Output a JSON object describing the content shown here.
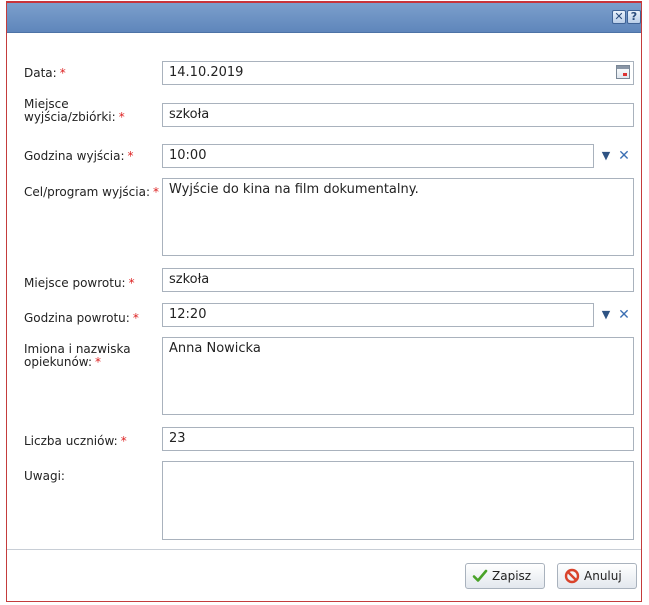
{
  "window": {
    "close_icon": "close-icon",
    "help_label": "?"
  },
  "form": {
    "date": {
      "label": "Data:",
      "value": "14.10.2019",
      "icon": "calendar-icon"
    },
    "place_out": {
      "label": "Miejsce wyjścia/zbiórki:",
      "value": "szkoła"
    },
    "time_out": {
      "label": "Godzina wyjścia:",
      "value": "10:00"
    },
    "purpose": {
      "label": "Cel/program wyjścia:",
      "value": "Wyjście do kina na film dokumentalny."
    },
    "place_back": {
      "label": "Miejsce powrotu:",
      "value": "szkoła"
    },
    "time_back": {
      "label": "Godzina powrotu:",
      "value": "12:20"
    },
    "guardians": {
      "label": "Imiona i nazwiska opiekunów:",
      "value": "Anna Nowicka"
    },
    "students": {
      "label": "Liczba uczniów:",
      "value": "23"
    },
    "notes": {
      "label": "Uwagi:",
      "value": ""
    },
    "required_mark": "*"
  },
  "buttons": {
    "save": "Zapisz",
    "cancel": "Anuluj"
  },
  "colors": {
    "titlebar": "#6a90c2",
    "required": "#dd2222",
    "border_red": "#c8343a"
  }
}
